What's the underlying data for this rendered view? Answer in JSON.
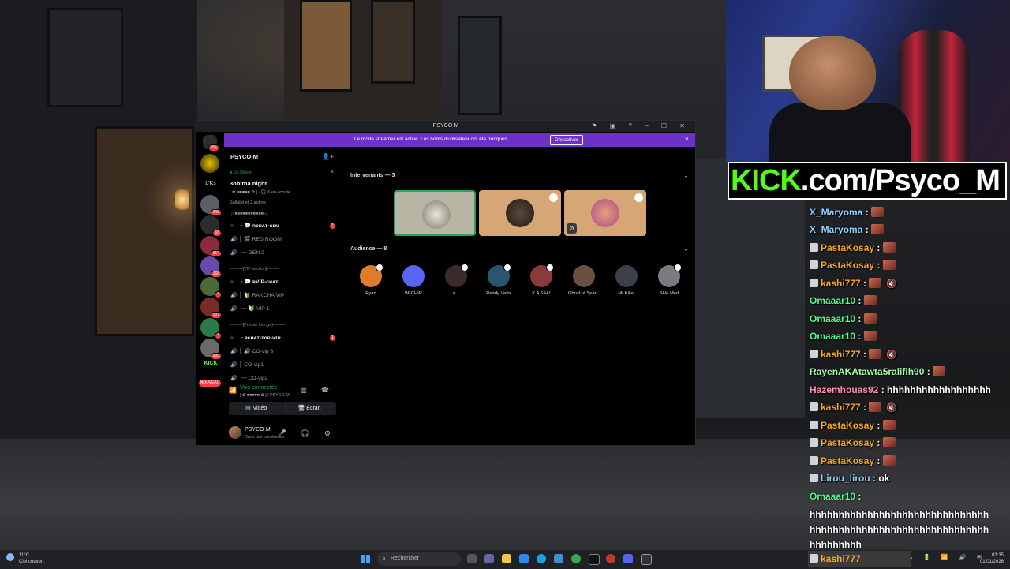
{
  "window": {
    "title": "PSYCO-M",
    "banner_text": "Le mode streamer est activé. Les noms d'utilisateur ont été tronqués.",
    "banner_button": "Désactiver",
    "banner_close": "×",
    "titlebar_icons": "⚑ ▣ ? – ☐ ✕"
  },
  "rail": {
    "top_badge": "16+",
    "lks_label": "L'Ks",
    "servers": [
      {
        "badge": "348"
      },
      {
        "badge": "16"
      },
      {
        "badge": "614"
      },
      {
        "badge": "168"
      },
      {
        "badge": "4"
      },
      {
        "badge": "137"
      },
      {
        "badge": "4"
      },
      {
        "badge": "599"
      }
    ],
    "kick_label": "KICK",
    "kick_badge": "4",
    "new_label": "NOUVEAU"
  },
  "channels": {
    "server_name": "PSYCO-M",
    "live_label": "● En Direct",
    "event_title": "3obitha night",
    "event_sub": "[ ✿ ■■■■■ ✿ ] · 🎧 6 en écoute",
    "event_sub2": "Sallabé et 2 autres",
    "rows": [
      {
        "kind": "cat",
        "label": "┌[■■■■■■■■■■■]┐"
      },
      {
        "kind": "text",
        "icon": "#",
        "label": "┌ 💬 ʀcʜᴀᴛ-ɢᴇɴ",
        "badge": "1"
      },
      {
        "kind": "voice",
        "icon": "🔊",
        "label": "│ 🎬 RED ROOM"
      },
      {
        "kind": "voice",
        "icon": "🔊",
        "label": "└─ GEN 2"
      },
      {
        "kind": "cat",
        "label": "────[VIP section]────"
      },
      {
        "kind": "text",
        "icon": "#",
        "label": "┌ 💬 ʀVIP-ᴄʜᴀᴛ"
      },
      {
        "kind": "voice",
        "icon": "🔊",
        "label": "│ 🔰 RAKCHA VIP"
      },
      {
        "kind": "voice",
        "icon": "🔊",
        "label": "└─ 🔰 VIP 1"
      },
      {
        "kind": "cat",
        "label": "────[Private lounge]────"
      },
      {
        "kind": "text",
        "icon": "#",
        "label": "┌ ʀᴄʜᴀᴛ-ᴛᴏᴘ-ᴠɪᴘ",
        "badge": "1"
      },
      {
        "kind": "voice",
        "icon": "🔊",
        "label": "│ 🔊 CO-vip 3"
      },
      {
        "kind": "voice",
        "icon": "🔊",
        "label": "│ CO-vip1"
      },
      {
        "kind": "voice",
        "icon": "🔊",
        "label": "└─ CO-vip2"
      }
    ],
    "voice_status": "Voix connectée",
    "voice_sub": "[ ✿ ■■■■■ ✿ ] / PSYCO-M",
    "video_label": "📹 Vidéo",
    "screen_label": "🖥 Écran",
    "user_name": "PSYCO-M",
    "user_status": "Dans une conférence",
    "user_controls": "🎤 🎧 ⚙"
  },
  "stage": {
    "speakers_header": "Intervenants — 3",
    "audience_header": "Audience — 8",
    "audience": [
      {
        "name": "Ryan",
        "color": "#e07b2a"
      },
      {
        "name": "BECHIR",
        "color": "#5865f2"
      },
      {
        "name": "e...",
        "color": "#3a2a2a"
      },
      {
        "name": "Ready Vertx",
        "color": "#2a5570"
      },
      {
        "name": "K A S H I",
        "color": "#8a3a3a"
      },
      {
        "name": "Ghost of Spar...",
        "color": "#6a5040"
      },
      {
        "name": "Mr Killer",
        "color": "#3a3f4a"
      },
      {
        "name": "3Alé Med",
        "color": "#7a7a80"
      }
    ]
  },
  "brand": {
    "kick": "KICK",
    "rest": ".com/Psyco_M"
  },
  "chat": [
    {
      "user": "X_Maryoma",
      "cls": "c-blue",
      "text": "",
      "emote": true
    },
    {
      "user": "X_Maryoma",
      "cls": "c-blue",
      "text": "",
      "emote": true
    },
    {
      "user": "PastaKosay",
      "cls": "c-orange",
      "text": "",
      "emote": true,
      "mod": true
    },
    {
      "user": "PastaKosay",
      "cls": "c-orange",
      "text": "",
      "emote": true,
      "mod": true
    },
    {
      "user": "kashi777",
      "cls": "c-orange",
      "text": "",
      "emote": true,
      "mod": true,
      "mute": true
    },
    {
      "user": "Omaaar10",
      "cls": "c-green",
      "text": "",
      "emote": true
    },
    {
      "user": "Omaaar10",
      "cls": "c-green",
      "text": "",
      "emote": true
    },
    {
      "user": "Omaaar10",
      "cls": "c-green",
      "text": "",
      "emote": true
    },
    {
      "user": "kashi777",
      "cls": "c-orange",
      "text": "",
      "emote": true,
      "mod": true,
      "mute": true
    },
    {
      "user": "RayenAKAtawta5ralifih90",
      "cls": "c-lg",
      "text": "",
      "emote": true
    },
    {
      "user": "Hazemhouas92",
      "cls": "c-pink",
      "text": "hhhhhhhhhhhhhhhhhh",
      "emote": false
    },
    {
      "user": "kashi777",
      "cls": "c-orange",
      "text": "",
      "emote": true,
      "mod": true,
      "mute": true
    },
    {
      "user": "PastaKosay",
      "cls": "c-orange",
      "text": "",
      "emote": true,
      "mod": true
    },
    {
      "user": "PastaKosay",
      "cls": "c-orange",
      "text": "",
      "emote": true,
      "mod": true
    },
    {
      "user": "PastaKosay",
      "cls": "c-orange",
      "text": "",
      "emote": true,
      "mod": true
    },
    {
      "user": "Lirou_lirou",
      "cls": "c-blue",
      "text": "ok",
      "emote": false,
      "mod": true
    },
    {
      "user": "Omaaar10",
      "cls": "c-green",
      "text": "",
      "emote": false
    }
  ],
  "chat_last_text": "hhhhhhhhhhhhhhhhhhhhhhhhhhhhhhhhhhhhhhhhhhhhhhhhhhhhhhhhhhhhhhhhhhhhhhh",
  "chat_bottom_user": "kashi777",
  "taskbar": {
    "weather_temp": "11°C",
    "weather_desc": "Ciel couvert",
    "search_placeholder": "Rechercher",
    "time": "03:35",
    "date": "01/01/2026",
    "tray": "^ ☁ 🔋 📶 🔊 ✉"
  }
}
